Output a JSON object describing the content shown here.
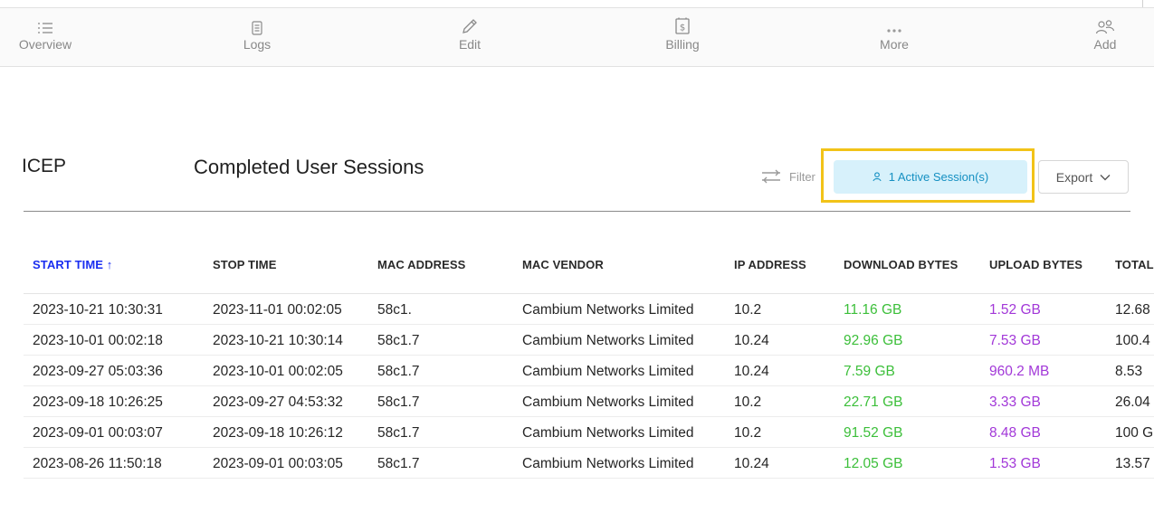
{
  "toolbar": {
    "items": [
      {
        "label": "Overview",
        "icon": "list-icon"
      },
      {
        "label": "Logs",
        "icon": "document-icon"
      },
      {
        "label": "Edit",
        "icon": "pencil-icon"
      },
      {
        "label": "Billing",
        "icon": "billing-icon"
      },
      {
        "label": "More",
        "icon": "more-dots-icon"
      },
      {
        "label": "Add",
        "icon": "add-users-icon"
      }
    ]
  },
  "header": {
    "brand": "ICEP",
    "title": "Completed User Sessions",
    "filter_label": "Filter",
    "active_sessions_label": "1 Active Session(s)",
    "export_label": "Export"
  },
  "table": {
    "columns": [
      "START TIME",
      "STOP TIME",
      "MAC ADDRESS",
      "MAC VENDOR",
      "IP ADDRESS",
      "DOWNLOAD BYTES",
      "UPLOAD BYTES",
      "TOTAL"
    ],
    "sorted_indicator": "↑",
    "rows": [
      {
        "start": "2023-10-21 10:30:31",
        "stop": "2023-11-01 00:02:05",
        "mac": "58c1.",
        "vendor": "Cambium Networks Limited",
        "ip": "10.2",
        "download": "11.16 GB",
        "upload": "1.52 GB",
        "total": "12.68"
      },
      {
        "start": "2023-10-01 00:02:18",
        "stop": "2023-10-21 10:30:14",
        "mac": "58c1.7",
        "vendor": "Cambium Networks Limited",
        "ip": "10.24",
        "download": "92.96 GB",
        "upload": "7.53 GB",
        "total": "100.4"
      },
      {
        "start": "2023-09-27 05:03:36",
        "stop": "2023-10-01 00:02:05",
        "mac": "58c1.7",
        "vendor": "Cambium Networks Limited",
        "ip": "10.24",
        "download": "7.59 GB",
        "upload": "960.2 MB",
        "total": "8.53"
      },
      {
        "start": "2023-09-18 10:26:25",
        "stop": "2023-09-27 04:53:32",
        "mac": "58c1.7",
        "vendor": "Cambium Networks Limited",
        "ip": "10.2",
        "download": "22.71 GB",
        "upload": "3.33 GB",
        "total": "26.04"
      },
      {
        "start": "2023-09-01 00:03:07",
        "stop": "2023-09-18 10:26:12",
        "mac": "58c1.7",
        "vendor": "Cambium Networks Limited",
        "ip": "10.2",
        "download": "91.52 GB",
        "upload": "8.48 GB",
        "total": "100 G"
      },
      {
        "start": "2023-08-26 11:50:18",
        "stop": "2023-09-01 00:03:05",
        "mac": "58c1.7",
        "vendor": "Cambium Networks Limited",
        "ip": "10.24",
        "download": "12.05 GB",
        "upload": "1.53 GB",
        "total": "13.57"
      }
    ]
  },
  "colors": {
    "download": "#3cbf3a",
    "upload": "#a238d8",
    "sorted_header": "#1a2ef0",
    "active_button_bg": "#d7f1fb",
    "active_button_text": "#1590c2",
    "highlight_border": "#f2c318"
  }
}
